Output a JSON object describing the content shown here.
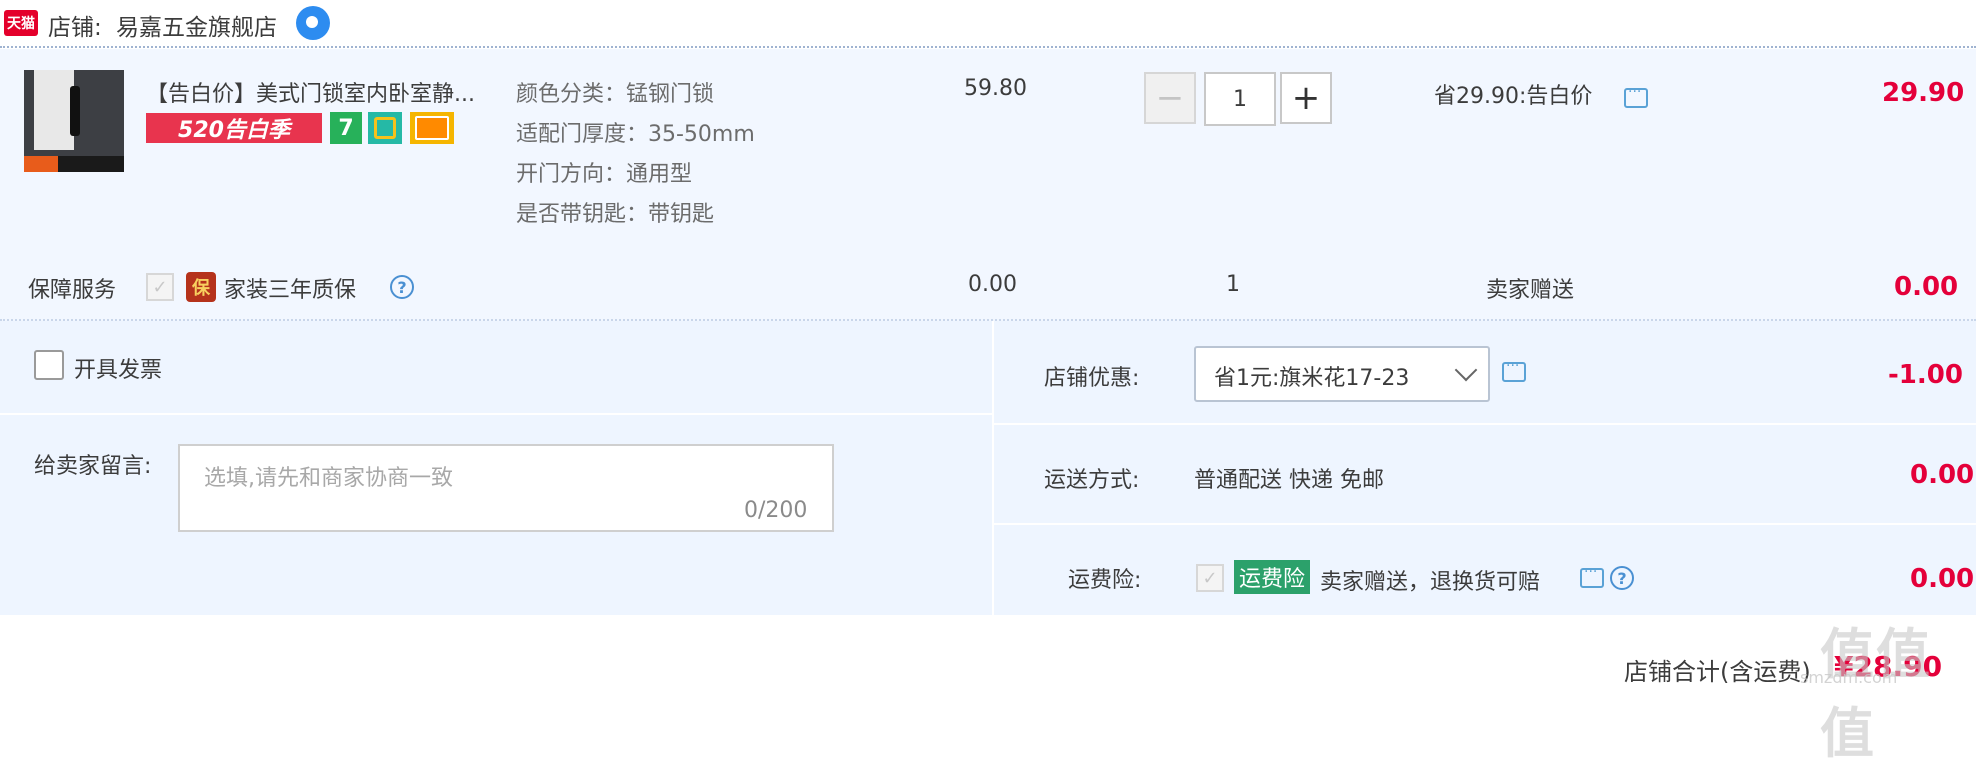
{
  "header": {
    "tmall_badge": "天猫",
    "shop_label": "店铺:",
    "shop_name": "易嘉五金旗舰店"
  },
  "item": {
    "title": "【告白价】美式门锁室内卧室静...",
    "promo_tag": "520告白季",
    "tag_seven": "7",
    "specs": [
      "颜色分类：锰钢门锁",
      "适配门厚度：35-50mm",
      "开门方向：通用型",
      "是否带钥匙：带钥匙"
    ],
    "unit_price": "59.80",
    "quantity": "1",
    "discount_note": "省29.90:告白价",
    "subtotal": "29.90"
  },
  "service": {
    "label": "保障服务",
    "bao_badge": "保",
    "name": "家装三年质保",
    "price": "0.00",
    "quantity": "1",
    "note": "卖家赠送",
    "subtotal": "0.00"
  },
  "invoice": {
    "label": "开具发票"
  },
  "message": {
    "label": "给卖家留言:",
    "placeholder": "选填,请先和商家协商一致",
    "counter": "0/200"
  },
  "coupon": {
    "label": "店铺优惠:",
    "selected": "省1元:旗米花17-23",
    "amount": "-1.00"
  },
  "shipping": {
    "label": "运送方式:",
    "method": "普通配送 快递 免邮",
    "amount": "0.00"
  },
  "insurance": {
    "label": "运费险:",
    "badge": "运费险",
    "desc": "卖家赠送，退换货可赔",
    "amount": "0.00"
  },
  "total": {
    "label": "店铺合计(含运费)",
    "amount": "¥28.90"
  },
  "watermark": {
    "logo": "值值值",
    "site": "smzdm.com"
  },
  "icons": {
    "tmall": "tmall-logo-icon",
    "wangwang": "wangwang-chat-icon",
    "message": "message-icon",
    "help": "help-icon"
  },
  "colors": {
    "price_red": "#e4003a",
    "panel_blue": "#eef5ff",
    "insurance_green": "#2ca16b"
  }
}
